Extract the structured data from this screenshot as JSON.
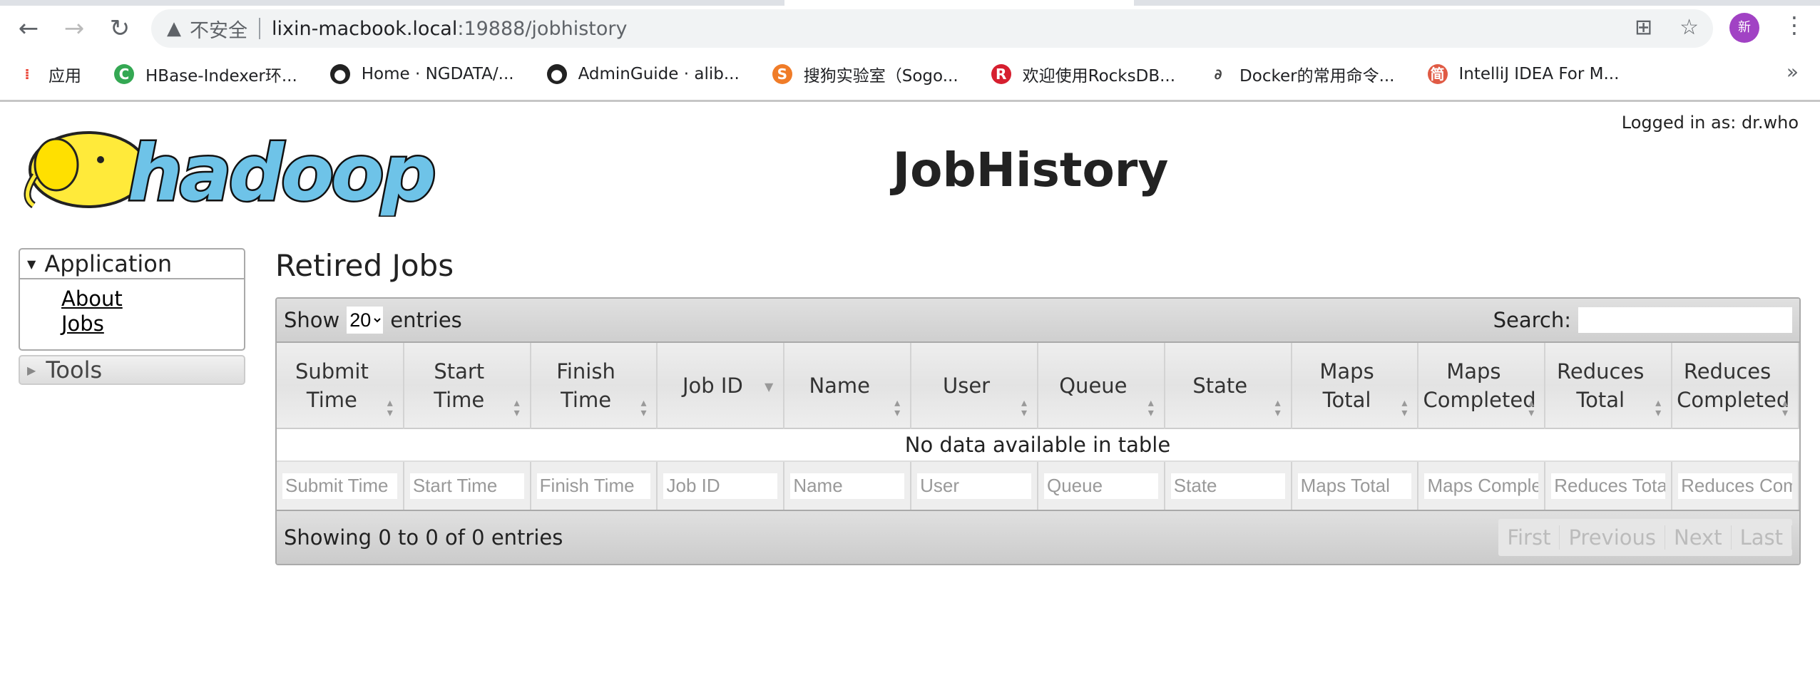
{
  "browser": {
    "insecure_label": "不安全",
    "url_host": "lixin-macbook.local",
    "url_path": ":19888/jobhistory",
    "avatar": "新",
    "bookmarks": [
      {
        "label": "应用",
        "icon": "apps-grid-icon",
        "color": "#ea4335"
      },
      {
        "label": "HBase-Indexer环...",
        "icon": "c-icon",
        "color": "#34a853"
      },
      {
        "label": "Home · NGDATA/...",
        "icon": "github-icon",
        "color": "#222"
      },
      {
        "label": "AdminGuide · alib...",
        "icon": "github-icon",
        "color": "#222"
      },
      {
        "label": "搜狗实验室（Sogo...",
        "icon": "sogou-icon",
        "color": "#f07c28"
      },
      {
        "label": "欢迎使用RocksDB...",
        "icon": "rocksdb-icon",
        "color": "#d61f2f"
      },
      {
        "label": "Docker的常用命令...",
        "icon": "docker-icon",
        "color": "#444"
      },
      {
        "label": "IntelliJ IDEA For M...",
        "icon": "jian-icon",
        "color": "#e05a44"
      }
    ],
    "more": "»"
  },
  "header": {
    "logo_text": "hadoop",
    "title": "JobHistory",
    "logged_in": "Logged in as: dr.who"
  },
  "sidebar": {
    "application": "Application",
    "links": [
      "About",
      "Jobs"
    ],
    "tools": "Tools"
  },
  "main": {
    "title": "Retired Jobs",
    "show": "Show",
    "page_size": "20",
    "entries": "entries",
    "search_label": "Search:",
    "columns": [
      "Submit Time",
      "Start Time",
      "Finish Time",
      "Job ID",
      "Name",
      "User",
      "Queue",
      "State",
      "Maps Total",
      "Maps Completed",
      "Reduces Total",
      "Reduces Completed"
    ],
    "empty": "No data available in table",
    "filters": [
      "Submit Time",
      "Start Time",
      "Finish Time",
      "Job ID",
      "Name",
      "User",
      "Queue",
      "State",
      "Maps Total",
      "Maps Completed",
      "Reduces Total",
      "Reduces Completed"
    ],
    "info": "Showing 0 to 0 of 0 entries",
    "pager": [
      "First",
      "Previous",
      "Next",
      "Last"
    ]
  }
}
